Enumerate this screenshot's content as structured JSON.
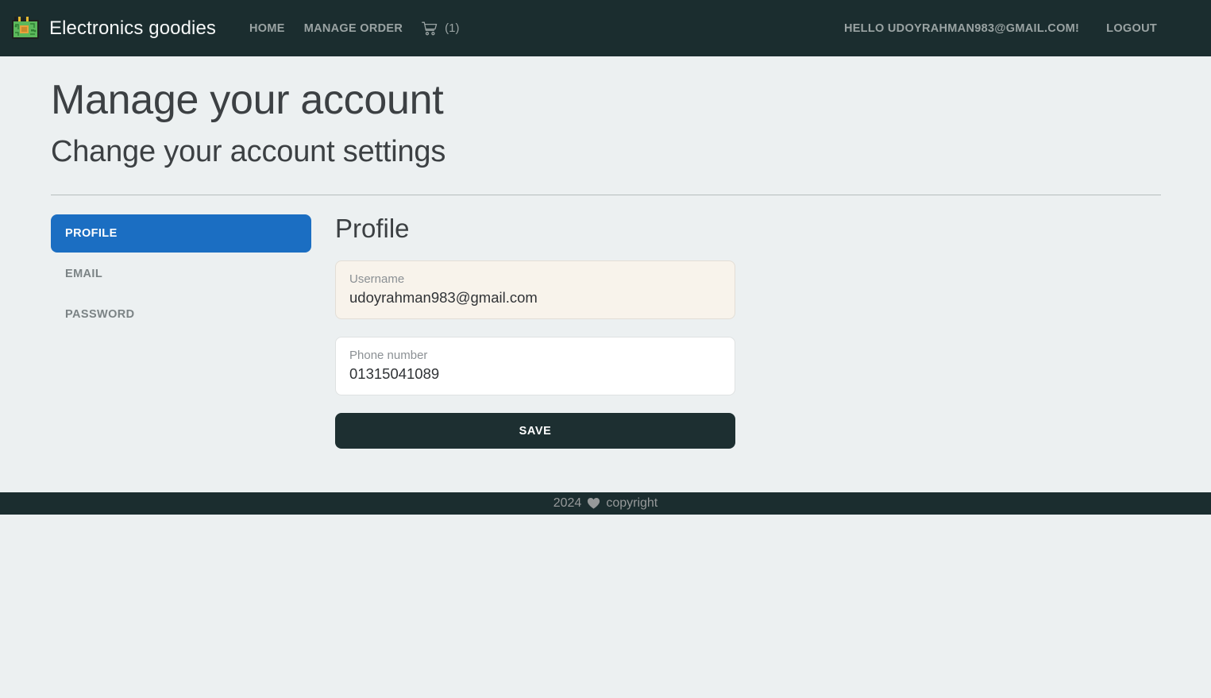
{
  "navbar": {
    "brand": "Electronics goodies",
    "brand_logo_icon": "circuit-board-icon",
    "links": [
      {
        "label": "HOME",
        "name": "nav-link-home"
      },
      {
        "label": "MANAGE ORDER",
        "name": "nav-link-manage-order"
      }
    ],
    "cart": {
      "icon": "shopping-cart-icon",
      "count_label": "(1)"
    },
    "greeting": "HELLO UDOYRAHMAN983@GMAIL.COM!",
    "logout": "LOGOUT",
    "background_color": "#1b2d2f",
    "link_color": "#9aa3a3"
  },
  "header": {
    "title": "Manage your account",
    "subtitle": "Change your account settings"
  },
  "sidebar": {
    "items": [
      {
        "label": "PROFILE",
        "active": true
      },
      {
        "label": "EMAIL",
        "active": false
      },
      {
        "label": "PASSWORD",
        "active": false
      }
    ],
    "active_color": "#1b6ec2",
    "inactive_color": "#7b8385"
  },
  "main": {
    "section_title": "Profile",
    "fields": [
      {
        "label": "Username",
        "value": "udoyrahman983@gmail.com",
        "placeholder": "Username",
        "autofilled": true
      },
      {
        "label": "Phone number",
        "value": "01315041089",
        "placeholder": "Phone number",
        "autofilled": false
      }
    ],
    "save_label": "SAVE",
    "save_color": "#1d2f31"
  },
  "footer": {
    "year": "2024",
    "heart_icon": "heart-icon",
    "copyright": "copyright",
    "background_color": "#1b2d2f",
    "text_color": "#96999a"
  }
}
